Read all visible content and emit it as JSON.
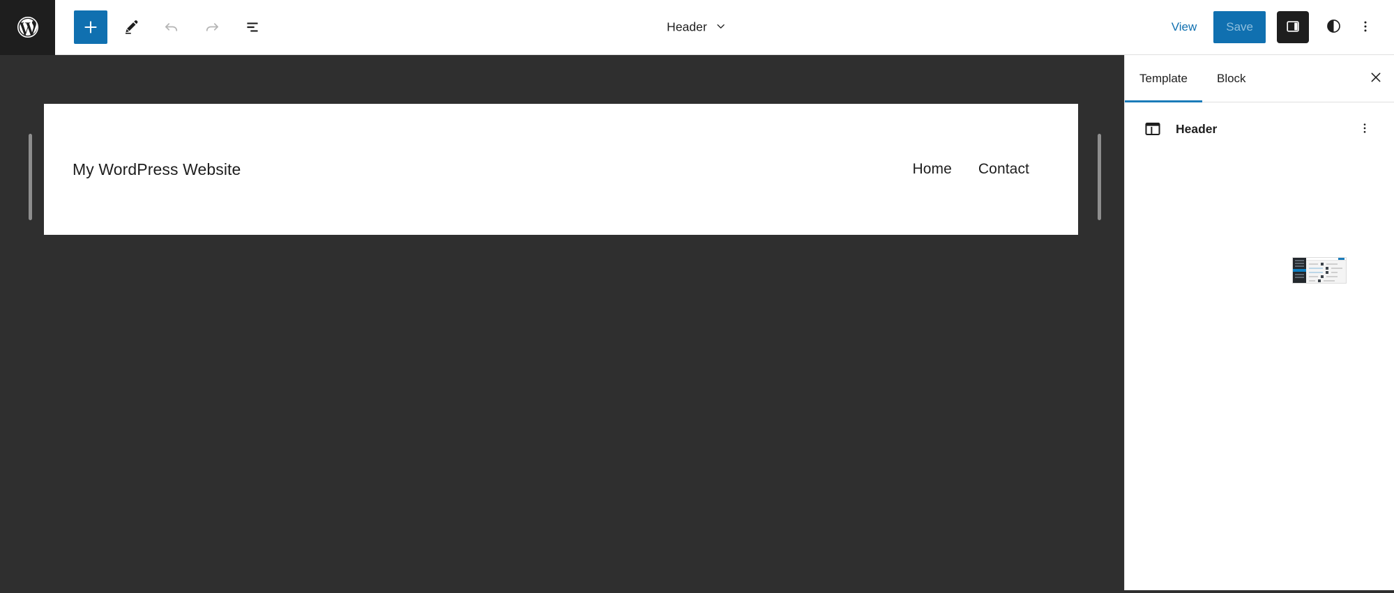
{
  "app": {
    "name": "WordPress Site Editor",
    "logo_icon": "wordpress-logo-icon"
  },
  "toolbar": {
    "add_block_label": "+",
    "add_block_icon": "plus-icon",
    "add_block_color": "#1070b0",
    "tools_icon": "pencil-edit-icon",
    "undo_icon": "undo-arrow-icon",
    "undo_enabled": false,
    "redo_icon": "redo-arrow-icon",
    "redo_enabled": false,
    "list_view_icon": "list-view-icon",
    "document_title": "Header",
    "document_title_chevron": "chevron-down-icon",
    "view_label": "View",
    "view_color": "#1070b0",
    "save_label": "Save",
    "save_enabled": false,
    "save_bg": "#1070b0",
    "save_text_color": "#8fbfdd",
    "settings_toggle_icon": "sidebar-panel-icon",
    "settings_toggle_active": true,
    "styles_icon": "contrast-half-circle-icon",
    "options_icon": "ellipsis-vertical-icon"
  },
  "canvas": {
    "background": "#2f2f2f",
    "left_resize_handle": "resize-handle-left",
    "right_resize_handle": "resize-handle-right",
    "site_header": {
      "site_title": "My WordPress Website",
      "nav_items": [
        {
          "label": "Home"
        },
        {
          "label": "Contact"
        }
      ]
    }
  },
  "sidebar": {
    "tabs": [
      {
        "label": "Template",
        "active": true
      },
      {
        "label": "Block",
        "active": false
      }
    ],
    "close_icon": "close-x-icon",
    "active_tab_underline_color": "#1a7bb9",
    "block_card": {
      "icon": "template-layout-icon",
      "title": "Header",
      "more_icon": "ellipsis-vertical-icon"
    },
    "preview_thumbnail": {
      "name": "template-preview-thumbnail"
    }
  }
}
